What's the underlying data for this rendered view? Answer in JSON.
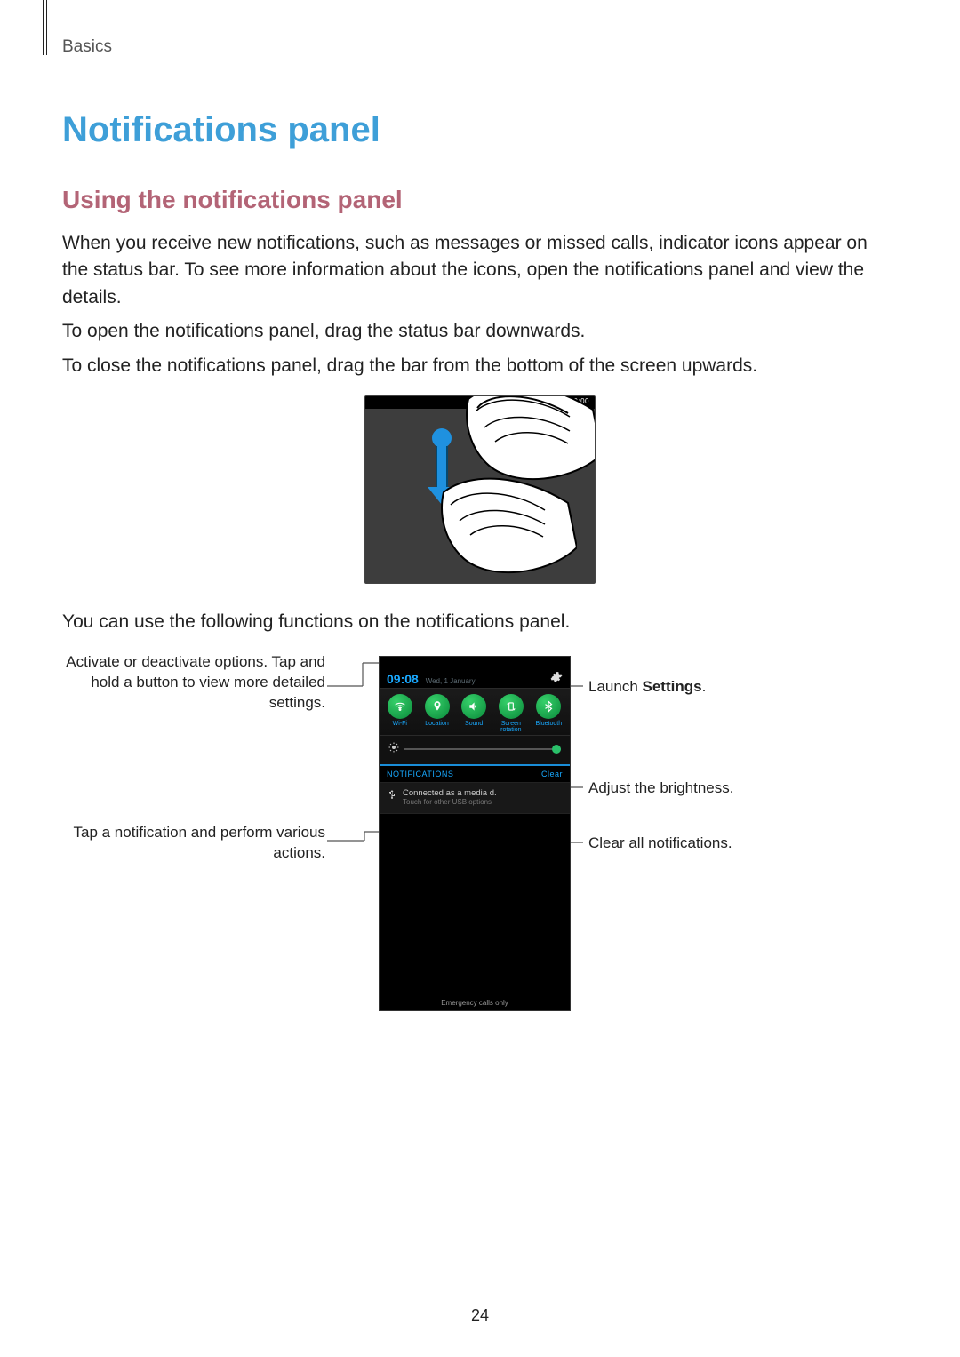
{
  "header_section": "Basics",
  "title": "Notifications panel",
  "subtitle": "Using the notifications panel",
  "para1": "When you receive new notifications, such as messages or missed calls, indicator icons appear on the status bar. To see more information about the icons, open the notifications panel and view the details.",
  "para2": "To open the notifications panel, drag the status bar downwards.",
  "para3": "To close the notifications panel, drag the bar from the bottom of the screen upwards.",
  "para4": "You can use the following functions on the notifications panel.",
  "gesture": {
    "statusbar_time": "10:00"
  },
  "panel": {
    "time": "09:08",
    "date": "Wed, 1 January",
    "toggles": [
      {
        "label": "Wi-Fi"
      },
      {
        "label": "Location"
      },
      {
        "label": "Sound"
      },
      {
        "label": "Screen\nrotation"
      },
      {
        "label": "Bluetooth"
      }
    ],
    "notif_header": "NOTIFICATIONS",
    "clear_label": "Clear",
    "notif_title": "Connected as a media d.",
    "notif_sub": "Touch for other USB options",
    "footer": "Emergency calls only"
  },
  "callouts": {
    "left1": "Activate or deactivate options. Tap and hold a button to view more detailed settings.",
    "left2": "Tap a notification and perform various actions.",
    "right1_pre": "Launch ",
    "right1_bold": "Settings",
    "right1_post": ".",
    "right2": "Adjust the brightness.",
    "right3": "Clear all notifications."
  },
  "page_number": "24"
}
